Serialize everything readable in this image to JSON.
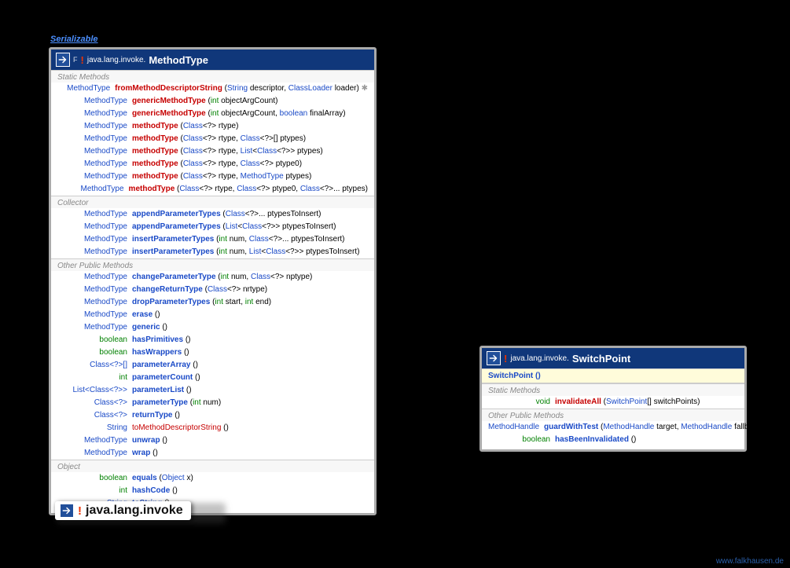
{
  "interfaceLink": "Serializable",
  "methodType": {
    "package": "java.lang.invoke.",
    "name": "MethodType",
    "sections": {
      "staticLabel": "Static Methods",
      "static": [
        {
          "ret": "MethodType",
          "name": "fromMethodDescriptorString",
          "style": "red",
          "params": [
            [
              "String",
              "descriptor",
              false
            ],
            [
              "ClassLoader",
              "loader",
              true
            ]
          ],
          "throws": true
        },
        {
          "ret": "MethodType",
          "name": "genericMethodType",
          "style": "red",
          "params": [
            [
              "int",
              "objectArgCount",
              false
            ]
          ]
        },
        {
          "ret": "MethodType",
          "name": "genericMethodType",
          "style": "red",
          "params": [
            [
              "int",
              "objectArgCount",
              false
            ],
            [
              "boolean",
              "finalArray",
              true
            ]
          ]
        },
        {
          "ret": "MethodType",
          "name": "methodType",
          "style": "red",
          "paramsRaw": "(Class<?> rtype)"
        },
        {
          "ret": "MethodType",
          "name": "methodType",
          "style": "red",
          "paramsRaw": "(Class<?> rtype, Class<?>[] ptypes)"
        },
        {
          "ret": "MethodType",
          "name": "methodType",
          "style": "red",
          "paramsRaw": "(Class<?> rtype, List<Class<?>> ptypes)"
        },
        {
          "ret": "MethodType",
          "name": "methodType",
          "style": "red",
          "paramsRaw": "(Class<?> rtype, Class<?> ptype0)"
        },
        {
          "ret": "MethodType",
          "name": "methodType",
          "style": "red",
          "paramsRaw": "(Class<?> rtype, MethodType ptypes)"
        },
        {
          "ret": "MethodType",
          "name": "methodType",
          "style": "red",
          "paramsRaw": "(Class<?> rtype, Class<?> ptype0, Class<?>... ptypes)"
        }
      ],
      "collectorLabel": "Collector",
      "collector": [
        {
          "ret": "MethodType",
          "name": "appendParameterTypes",
          "style": "blue",
          "paramsRaw": "(Class<?>... ptypesToInsert)"
        },
        {
          "ret": "MethodType",
          "name": "appendParameterTypes",
          "style": "blue",
          "paramsRaw": "(List<Class<?>> ptypesToInsert)"
        },
        {
          "ret": "MethodType",
          "name": "insertParameterTypes",
          "style": "blue",
          "paramsRaw": "(int num, Class<?>... ptypesToInsert)"
        },
        {
          "ret": "MethodType",
          "name": "insertParameterTypes",
          "style": "blue",
          "paramsRaw": "(int num, List<Class<?>> ptypesToInsert)"
        }
      ],
      "otherLabel": "Other Public Methods",
      "other": [
        {
          "ret": "MethodType",
          "name": "changeParameterType",
          "style": "blue",
          "paramsRaw": "(int num, Class<?> nptype)"
        },
        {
          "ret": "MethodType",
          "name": "changeReturnType",
          "style": "blue",
          "paramsRaw": "(Class<?> nrtype)"
        },
        {
          "ret": "MethodType",
          "name": "dropParameterTypes",
          "style": "blue",
          "paramsRaw": "(int start, int end)"
        },
        {
          "ret": "MethodType",
          "name": "erase",
          "style": "blue",
          "paramsRaw": "()"
        },
        {
          "ret": "MethodType",
          "name": "generic",
          "style": "blue",
          "paramsRaw": "()"
        },
        {
          "ret": "boolean",
          "retGreen": true,
          "name": "hasPrimitives",
          "style": "blue",
          "paramsRaw": "()"
        },
        {
          "ret": "boolean",
          "retGreen": true,
          "name": "hasWrappers",
          "style": "blue",
          "paramsRaw": "()"
        },
        {
          "ret": "Class<?>[]",
          "name": "parameterArray",
          "style": "blue",
          "paramsRaw": "()"
        },
        {
          "ret": "int",
          "retGreen": true,
          "name": "parameterCount",
          "style": "blue",
          "paramsRaw": "()"
        },
        {
          "ret": "List<Class<?>>",
          "name": "parameterList",
          "style": "blue",
          "paramsRaw": "()"
        },
        {
          "ret": "Class<?>",
          "name": "parameterType",
          "style": "blue",
          "paramsRaw": "(int num)"
        },
        {
          "ret": "Class<?>",
          "name": "returnType",
          "style": "blue",
          "paramsRaw": "()"
        },
        {
          "ret": "String",
          "name": "toMethodDescriptorString",
          "style": "red-nb",
          "paramsRaw": "()"
        },
        {
          "ret": "MethodType",
          "name": "unwrap",
          "style": "blue",
          "paramsRaw": "()"
        },
        {
          "ret": "MethodType",
          "name": "wrap",
          "style": "blue",
          "paramsRaw": "()"
        }
      ],
      "objectLabel": "Object",
      "object": [
        {
          "ret": "boolean",
          "retGreen": true,
          "name": "equals",
          "style": "blue",
          "paramsRaw": "(Object x)"
        },
        {
          "ret": "int",
          "retGreen": true,
          "name": "hashCode",
          "style": "blue",
          "paramsRaw": "()"
        },
        {
          "ret": "String",
          "name": "toString",
          "style": "blue",
          "paramsRaw": "()"
        }
      ]
    }
  },
  "switchPoint": {
    "package": "java.lang.invoke.",
    "name": "SwitchPoint",
    "constructor": "SwitchPoint ()",
    "sections": {
      "staticLabel": "Static Methods",
      "static": [
        {
          "ret": "void",
          "retGreen": true,
          "name": "invalidateAll",
          "style": "red",
          "paramsRaw": "(SwitchPoint[] switchPoints)"
        }
      ],
      "otherLabel": "Other Public Methods",
      "other": [
        {
          "ret": "MethodHandle",
          "name": "guardWithTest",
          "style": "blue",
          "paramsRaw": "(MethodHandle target, MethodHandle fallback)"
        },
        {
          "ret": "boolean",
          "retGreen": true,
          "name": "hasBeenInvalidated",
          "style": "blue",
          "paramsRaw": "()"
        }
      ]
    }
  },
  "packageBadge": {
    "name": "java.lang.invoke"
  },
  "watermark": "www.falkhausen.de"
}
